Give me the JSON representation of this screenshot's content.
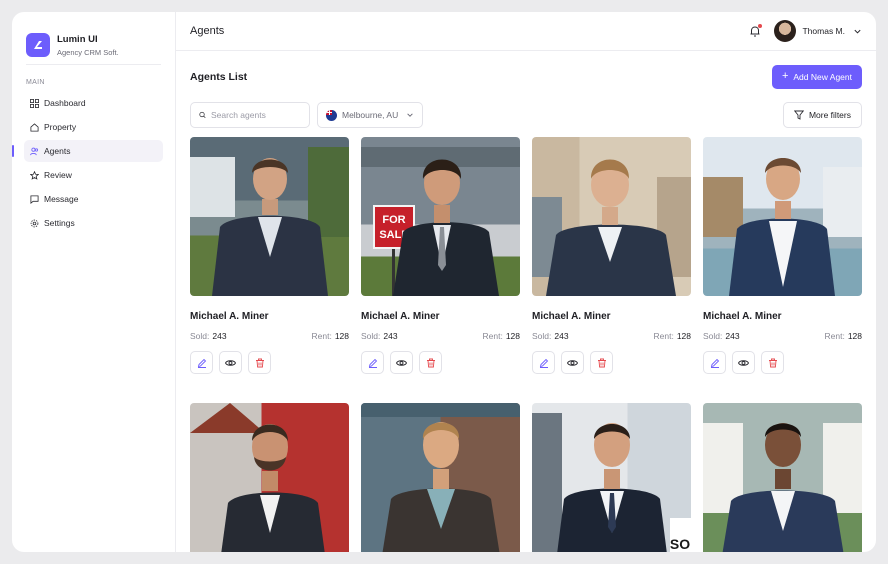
{
  "brand": {
    "name": "Lumin UI",
    "subtitle": "Agency CRM Soft."
  },
  "sidebar": {
    "section": "MAIN",
    "items": [
      {
        "label": "Dashboard",
        "icon": "grid-icon",
        "active": false
      },
      {
        "label": "Property",
        "icon": "home-icon",
        "active": false
      },
      {
        "label": "Agents",
        "icon": "users-icon",
        "active": true
      },
      {
        "label": "Review",
        "icon": "star-icon",
        "active": false
      },
      {
        "label": "Message",
        "icon": "chat-icon",
        "active": false
      },
      {
        "label": "Settings",
        "icon": "gear-icon",
        "active": false
      }
    ]
  },
  "header": {
    "title": "Agents",
    "user": "Thomas M."
  },
  "list": {
    "title": "Agents List",
    "add_button": "Add New Agent",
    "search_placeholder": "Search agents",
    "location": "Melbourne, AU",
    "more_filters": "More filters"
  },
  "colors": {
    "accent": "#6d5dfc",
    "danger": "#e5484d"
  },
  "agents": [
    {
      "name": "Michael A. Miner",
      "sold_label": "Sold:",
      "sold": "243",
      "rent_label": "Rent:",
      "rent": "128"
    },
    {
      "name": "Michael A. Miner",
      "sold_label": "Sold:",
      "sold": "243",
      "rent_label": "Rent:",
      "rent": "128"
    },
    {
      "name": "Michael A. Miner",
      "sold_label": "Sold:",
      "sold": "243",
      "rent_label": "Rent:",
      "rent": "128"
    },
    {
      "name": "Michael A. Miner",
      "sold_label": "Sold:",
      "sold": "243",
      "rent_label": "Rent:",
      "rent": "128"
    }
  ],
  "sale_sign": {
    "line1": "FOR",
    "line2": "SALE"
  },
  "partial_sign": "SO"
}
